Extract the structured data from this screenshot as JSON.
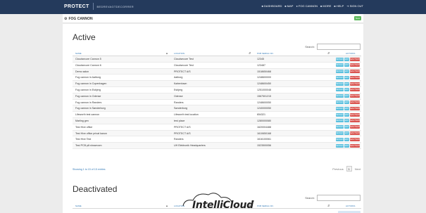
{
  "topbar": {
    "brand": "PROTECT",
    "subtitle": "BEDREVAGTDECORRER",
    "nav": [
      {
        "label": "DASHBOARD",
        "icon": "dashboard-icon"
      },
      {
        "label": "MAP",
        "icon": "map-icon"
      },
      {
        "label": "FOG CANNON",
        "icon": "fog-cannon-icon"
      },
      {
        "label": "MORE",
        "icon": "more-icon"
      },
      {
        "label": "HELP",
        "icon": "help-icon"
      },
      {
        "label": "SIGN OUT",
        "icon": "sign-out-icon"
      }
    ]
  },
  "subbar": {
    "title": "FOG CANNON",
    "badge": "New"
  },
  "active": {
    "heading": "Active",
    "search_label": "Search:",
    "columns": {
      "name": "NAME",
      "location": "LOCATION",
      "serial": "PCB SERIAL NO.",
      "actions": "ACTIONS"
    },
    "rows": [
      {
        "name": "Cloudsecure Cannon 5",
        "location": "Cloudsecure Test",
        "serial": "12345"
      },
      {
        "name": "Cloudsecure Cannon 6",
        "location": "Cloudsecure Test",
        "serial": "123487"
      },
      {
        "name": "Demo salon",
        "location": "PROTECT A/S",
        "serial": "1518650468"
      },
      {
        "name": "Fog cannon in Aalborg",
        "location": "Aalborg",
        "serial": "1248600000"
      },
      {
        "name": "Fog cannon in Copenhagen",
        "location": "København",
        "serial": "1248600450"
      },
      {
        "name": "Fog cannon in Esbjerg",
        "location": "Esbjerg",
        "serial": "1251000048"
      },
      {
        "name": "Fog cannon in Odense",
        "location": "Odense",
        "serial": "1567501215"
      },
      {
        "name": "Fog cannon in Randers",
        "location": "Randers",
        "serial": "1248600050"
      },
      {
        "name": "Fog cannon in Sønderborg",
        "location": "Sønderborg",
        "serial": "1240000050"
      },
      {
        "name": "Lifeworth test cannon",
        "location": "Lifeworth test location",
        "serial": "654321"
      },
      {
        "name": "Marling gen",
        "location": "test place",
        "serial": "1280000080"
      },
      {
        "name": "Test Hive office",
        "location": "PROTECT A/S",
        "serial": "1620004488"
      },
      {
        "name": "Test Hive office privat kanon",
        "location": "PROTECT A/S",
        "serial": "1610650168"
      },
      {
        "name": "Test Hive Test",
        "location": "Randers",
        "serial": "1616100061"
      },
      {
        "name": "Test PCB på showroom",
        "location": "UH Elektronik Headquarters",
        "serial": "1523500056"
      }
    ],
    "action_labels": {
      "details": "Details",
      "edit": "Edit",
      "deactivate": "Deactivate"
    },
    "showing": "Showing 1 to 15 of 15 entries",
    "pager": {
      "previous": "Previous",
      "current": "1",
      "next": "Next"
    }
  },
  "deactivated": {
    "heading": "Deactivated",
    "search_label": "Search:",
    "columns": {
      "name": "NAME",
      "location": "LOCATION",
      "serial": "PCB SERIAL NO.",
      "actions": "ACTIONS"
    }
  },
  "watermark": {
    "text": "IntelliCloud",
    "tm": "™"
  }
}
